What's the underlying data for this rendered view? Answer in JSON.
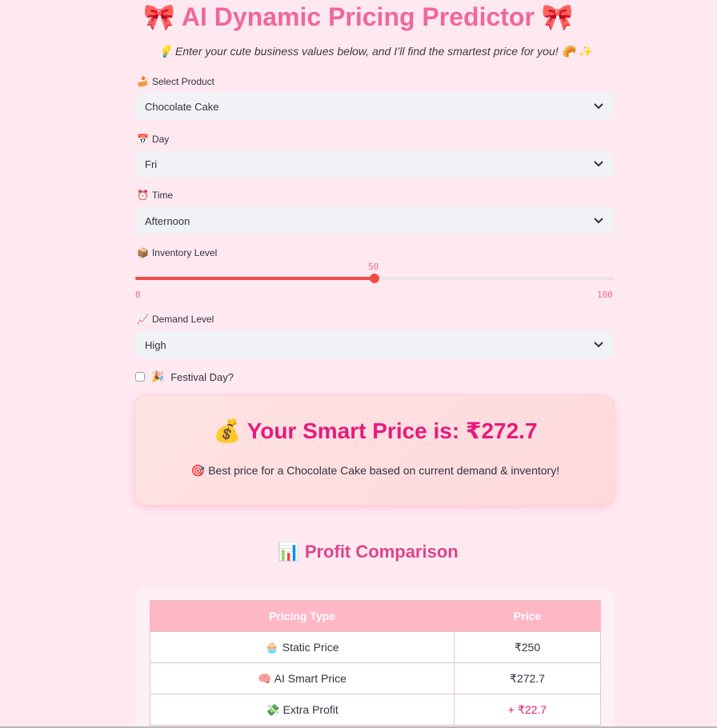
{
  "header": {
    "title": "AI Dynamic Pricing Predictor",
    "title_emoji_left": "🎀",
    "title_emoji_right": "🎀",
    "subtitle": "💡  Enter your cute business values below, and I’ll find the smartest price for you!  🥐 ✨"
  },
  "form": {
    "product": {
      "icon": "🍰",
      "label": "Select Product",
      "value": "Chocolate Cake"
    },
    "day": {
      "icon": "📅",
      "label": "Day",
      "value": "Fri"
    },
    "time": {
      "icon": "⏰",
      "label": "Time",
      "value": "Afternoon"
    },
    "inventory": {
      "icon": "📦",
      "label": "Inventory Level",
      "value": 50,
      "value_text": "50",
      "min": "0",
      "max": "100"
    },
    "demand": {
      "icon": "📈",
      "label": "Demand Level",
      "value": "High"
    },
    "festival": {
      "icon": "🎉",
      "label": "Festival Day?",
      "checked": false
    }
  },
  "result": {
    "icon": "💰",
    "headline": "Your Smart Price is: ₹272.7",
    "note_icon": "🎯",
    "note": "Best price for a Chocolate Cake based on current demand & inventory!"
  },
  "comparison": {
    "icon": "📊",
    "title": "Profit Comparison",
    "columns": [
      "Pricing Type",
      "Price"
    ],
    "rows": [
      {
        "icon": "🧁",
        "type": "Static Price",
        "price": "₹250"
      },
      {
        "icon": "🧠",
        "type": "AI Smart Price",
        "price": "₹272.7"
      },
      {
        "icon": "💸",
        "type": "Extra Profit",
        "price": "+ ₹22.7"
      }
    ]
  },
  "colors": {
    "accent": "#f0679b",
    "slider": "#ef4b4b",
    "table_header": "#ffb7c5",
    "background": "#ffe9f0"
  }
}
